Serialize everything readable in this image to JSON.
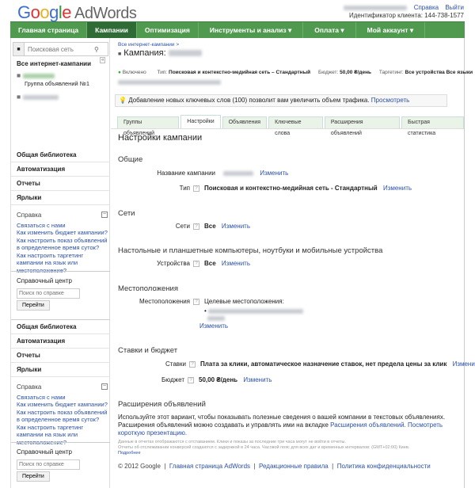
{
  "header": {
    "logo": "Google AdWords",
    "help": "Справка",
    "logout": "Выйти",
    "client_id": "Идентификатор клиента: 144-738-1577"
  },
  "nav": [
    {
      "label": "Главная страница"
    },
    {
      "label": "Кампании"
    },
    {
      "label": "Оптимизация"
    },
    {
      "label": "Инструменты и анализ ▾"
    },
    {
      "label": "Оплата ▾"
    },
    {
      "label": "Мой аккаунт ▾"
    }
  ],
  "sidebar": {
    "search_placeholder": "Поисковая сеть",
    "all_campaigns": "Все интернет-кампании",
    "ad_group": "Группа объявлений №1",
    "menu": [
      "Общая библиотека",
      "Автоматизация",
      "Отчеты",
      "Ярлыки"
    ],
    "help_title": "Справка",
    "help_links": [
      "Связаться с нами",
      "Как изменить бюджет кампании?",
      "Как настроить показ объявлений в определенное время суток?",
      "Как настроить таргетинг кампании на язык или местоположение?"
    ],
    "help_center": "Справочный центр",
    "help_search_placeholder": "Поиск по справке",
    "go_button": "Перейти"
  },
  "main": {
    "breadcrumb": "Все интернет-кампании >",
    "title": "Кампания:",
    "status": "Включено",
    "type_label": "Тип:",
    "type_value": "Поисковая и контекстно-медийная сеть – Стандартный",
    "budget_label": "Бюджет:",
    "budget_value": "50,00 ₴/день",
    "targeting_label": "Таргетинг:",
    "targeting_value": "Все устройства   Все языки",
    "notice": "Добавление новых ключевых слов (100) позволит вам увеличить объем трафика.",
    "notice_link": "Просмотреть",
    "tabs": [
      "Группы объявлений",
      "Настройки",
      "Объявления",
      "Ключевые слова",
      "Расширения объявлений",
      "Быстрая статистика"
    ],
    "settings_title": "Настройки кампании",
    "change": "Изменить",
    "general": "Общие",
    "campaign_name_label": "Название кампании",
    "type_row_label": "Тип",
    "type_row_value": "Поисковая и контекстно-медийная сеть - Стандартный",
    "networks": "Сети",
    "networks_label": "Сети",
    "networks_value": "Все",
    "devices_title": "Настольные и планшетные компьютеры, ноутбуки и мобильные устройства",
    "devices_label": "Устройства",
    "devices_value": "Все",
    "locations": "Местоположения",
    "locations_label": "Местоположения",
    "target_locations": "Целевые местоположения:",
    "bids_budget": "Ставки и бюджет",
    "bids_label": "Ставки",
    "bids_value": "Плата за клики, автоматическое назначение ставок, нет предела цены за клик",
    "budget_row_label": "Бюджет",
    "budget_row_value": "50,00 ₴/день",
    "extensions": "Расширения объявлений",
    "extensions_text": "Используйте этот вариант, чтобы показывать полезные сведения о вашей компании в текстовых объявлениях. Расширения объявлений можно создавать и управлять ими на вкладке",
    "extensions_link": "Расширения объявлений.",
    "presentation_link": "Посмотреть короткую презентацию.",
    "footnote1": "Данные в отчетах отображаются с отставанием. Клики и показы за последние три часа могут не войти в отчеты.",
    "footnote2": "Отчеты об отслеживании конверсий создаются с задержкой в 24 часа. Часовой пояс для всех дат и временных интервалов: (GMT+02:00) Киев.",
    "more": "Подробнее",
    "copyright": "© 2012 Google",
    "footer_links": [
      "Главная страница AdWords",
      "Редакционные правила",
      "Политика конфиденциальности"
    ]
  },
  "colors": {
    "nav": "#4f9a4f",
    "nav_active": "#2f6b35",
    "link": "#2a4fa8"
  }
}
